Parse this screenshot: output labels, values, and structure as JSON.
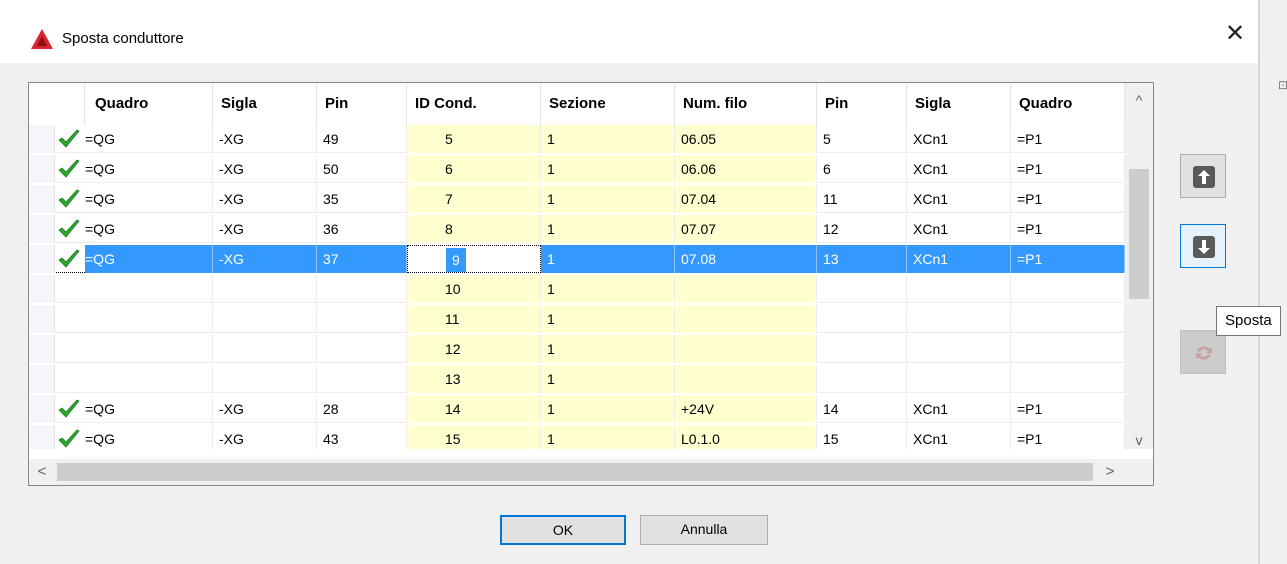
{
  "window": {
    "title": "Sposta conduttore",
    "close_glyph": "✕",
    "ghost_text": "⊡"
  },
  "grid": {
    "columns": [
      "Quadro",
      "Sigla",
      "Pin",
      "ID Cond.",
      "Sezione",
      "Num. filo",
      "Pin",
      "Sigla",
      "Quadro"
    ],
    "rows": [
      {
        "check": true,
        "cells": [
          "=QG",
          "-XG",
          "49",
          "5",
          "1",
          "06.05",
          "5",
          "XCn1",
          "=P1"
        ]
      },
      {
        "check": true,
        "cells": [
          "=QG",
          "-XG",
          "50",
          "6",
          "1",
          "06.06",
          "6",
          "XCn1",
          "=P1"
        ]
      },
      {
        "check": true,
        "cells": [
          "=QG",
          "-XG",
          "35",
          "7",
          "1",
          "07.04",
          "11",
          "XCn1",
          "=P1"
        ]
      },
      {
        "check": true,
        "cells": [
          "=QG",
          "-XG",
          "36",
          "8",
          "1",
          "07.07",
          "12",
          "XCn1",
          "=P1"
        ]
      },
      {
        "check": true,
        "selected": true,
        "cells": [
          "=QG",
          "-XG",
          "37",
          "9",
          "1",
          "07.08",
          "13",
          "XCn1",
          "=P1"
        ]
      },
      {
        "check": false,
        "cells": [
          "",
          "",
          "",
          "10",
          "1",
          "",
          "",
          "",
          ""
        ]
      },
      {
        "check": false,
        "cells": [
          "",
          "",
          "",
          "11",
          "1",
          "",
          "",
          "",
          ""
        ]
      },
      {
        "check": false,
        "cells": [
          "",
          "",
          "",
          "12",
          "1",
          "",
          "",
          "",
          ""
        ]
      },
      {
        "check": false,
        "cells": [
          "",
          "",
          "",
          "13",
          "1",
          "",
          "",
          "",
          ""
        ]
      },
      {
        "check": true,
        "cells": [
          "=QG",
          "-XG",
          "28",
          "14",
          "1",
          "+24V",
          "14",
          "XCn1",
          "=P1"
        ]
      },
      {
        "check": true,
        "cells": [
          "=QG",
          "-XG",
          "43",
          "15",
          "1",
          "L0.1.0",
          "15",
          "XCn1",
          "=P1"
        ]
      }
    ],
    "scroll_up_glyph": "^",
    "scroll_down_glyph": "v",
    "scroll_left_glyph": "<",
    "scroll_right_glyph": ">"
  },
  "tooltip": {
    "text": "Sposta"
  },
  "buttons": {
    "ok": "OK",
    "cancel": "Annulla"
  },
  "colors": {
    "selection": "#3399ff",
    "editable_column": "#ffffd0",
    "accent": "#0078d7",
    "check": "#2fa82f",
    "logo": "#d8252e"
  }
}
